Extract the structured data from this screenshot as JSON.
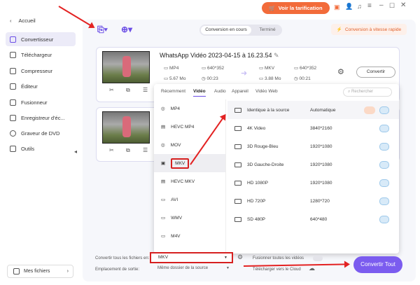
{
  "topbar": {
    "pricing": "Voir la tarification"
  },
  "sidebar": {
    "back": "Accueil",
    "items": [
      {
        "label": "Convertisseur"
      },
      {
        "label": "Téléchargeur"
      },
      {
        "label": "Compresseur"
      },
      {
        "label": "Éditeur"
      },
      {
        "label": "Fusionneur"
      },
      {
        "label": "Enregistreur d'éc..."
      },
      {
        "label": "Graveur de DVD"
      },
      {
        "label": "Outils"
      }
    ],
    "my_files": "Mes fichiers"
  },
  "toolbar": {
    "tab_active": "Conversion en cours",
    "tab_done": "Terminé",
    "fast": "Conversion à vitesse rapide"
  },
  "file": {
    "title": "WhatsApp Vidéo 2023-04-15 à 16.23.54",
    "src_format": "MP4",
    "src_res": "640*352",
    "src_size": "5.67 Mo",
    "src_dur": "00:23",
    "dst_format": "MKV",
    "dst_res": "640*352",
    "dst_size": "3.88 Mo",
    "dst_dur": "00:21",
    "convert": "Convertir"
  },
  "dropdown": {
    "tabs": [
      "Récemment",
      "Vidéo",
      "Audio",
      "Appareil",
      "Vidéo Web"
    ],
    "search_placeholder": "Rechercher",
    "formats": [
      "MP4",
      "HEVC MP4",
      "MOV",
      "MKV",
      "HEVC MKV",
      "AVI",
      "WMV",
      "M4V"
    ],
    "qualities": [
      {
        "name": "Identique à la source",
        "res": "Automatique"
      },
      {
        "name": "4K Video",
        "res": "3840*2160"
      },
      {
        "name": "3D Rouge-Bleu",
        "res": "1920*1080"
      },
      {
        "name": "3D Gauche-Droite",
        "res": "1920*1080"
      },
      {
        "name": "HD 1080P",
        "res": "1920*1080"
      },
      {
        "name": "HD 720P",
        "res": "1280*720"
      },
      {
        "name": "SD 480P",
        "res": "640*480"
      }
    ]
  },
  "bottom": {
    "convert_all_label": "Convertir tous les fichiers en:",
    "convert_all_value": "MKV",
    "output_label": "Emplacement de sortie:",
    "output_value": "Même dossier de la source",
    "merge": "Fusionner toutes les vidéos",
    "cloud": "Télécharger vers le Cloud",
    "convert_all_btn": "Convertir Tout"
  }
}
